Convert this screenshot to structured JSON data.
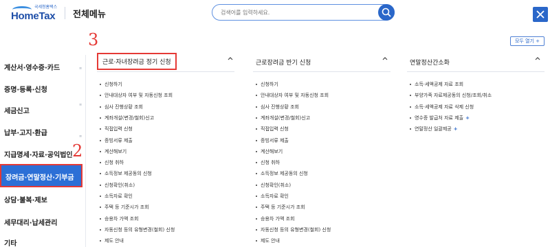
{
  "header": {
    "logo_small": "국세청홈택스",
    "logo_main": "HomeTax",
    "title": "전체메뉴",
    "search_placeholder": "검색어를 입력하세요."
  },
  "toolbar": {
    "expand_all_label": "모두 열기 +"
  },
  "annotations": {
    "step_2": "2",
    "step_3": "3"
  },
  "sidebar": {
    "items": [
      {
        "label": "계산서·영수증·카드"
      },
      {
        "label": "증명·등록·신청"
      },
      {
        "label": "세금신고"
      },
      {
        "label": "납부·고지·환급"
      },
      {
        "label": "지급명세·자료·공익법인"
      },
      {
        "label": "장려금·연말정산·기부금"
      },
      {
        "label": "상담·불복·제보"
      },
      {
        "label": "세무대리·납세관리"
      },
      {
        "label": "기타"
      }
    ]
  },
  "columns": [
    {
      "title": "근로·자녀장려금 정기 신청",
      "items": [
        "신청하기",
        "안내대상자 여부 및 자동신청 조회",
        "심사 진행상황 조회",
        "계좌개설(변경/철회)신고",
        "직접입력 신청",
        "증빙서류 제출",
        "계산해보기",
        "신청 취하",
        "소득정보 제공동의 신청",
        "신청확인(취소)",
        "소득자료 확인",
        "주택 등 기준시가 조회",
        "승용차 가액 조회",
        "자동신청 등의 유형변경(철회) 신청",
        "제도 안내"
      ]
    },
    {
      "title": "근로장려금 반기 신청",
      "items": [
        "신청하기",
        "안내대상자 여부 및 자동신청 조회",
        "심사 진행상황 조회",
        "계좌개설(변경/철회)신고",
        "직접입력 신청",
        "증빙서류 제출",
        "계산해보기",
        "신청 취하",
        "소득정보 제공동의 신청",
        "신청확인(취소)",
        "소득자료 확인",
        "주택 등 기준시가 조회",
        "승용차 가액 조회",
        "자동신청 등의 유형변경(철회) 신청",
        "제도 안내"
      ]
    },
    {
      "title": "연말정산간소화",
      "items": [
        "소득·세액공제 자료 조회",
        "부양가족 자료제공동의 신청/조회/취소",
        "소득·세액공제 자료 삭제 신청",
        "영수증 발급처 자료 제출",
        "연말정산 일괄제공"
      ],
      "plus_items": [
        "영수증 발급처 자료 제출",
        "연말정산 일괄제공"
      ]
    }
  ],
  "colors": {
    "accent": "#2a67c9",
    "active_bg": "#2c6fd6",
    "annotation": "#e53935"
  },
  "icons": [
    "search-icon",
    "close-icon",
    "chevron-up-icon",
    "plus-icon"
  ]
}
